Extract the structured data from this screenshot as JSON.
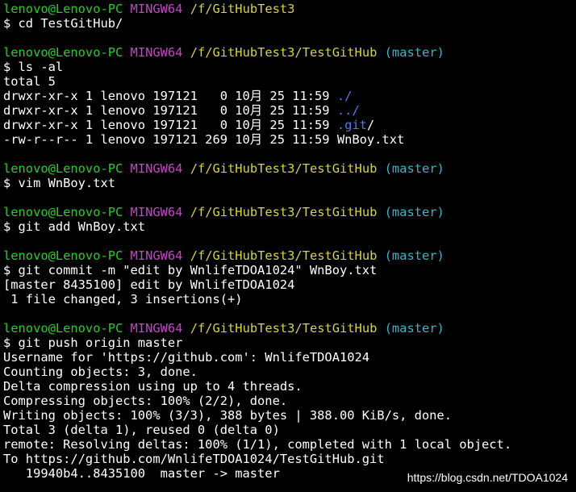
{
  "prompt": {
    "user_host": "lenovo@Lenovo-PC",
    "env": "MINGW64",
    "path_root": "/f/GitHubTest3",
    "path_repo": "/f/GitHubTest3/TestGitHub",
    "branch": "(master)"
  },
  "commands": {
    "cd": "$ cd TestGitHub/",
    "ls": "$ ls -al",
    "vim": "$ vim WnBoy.txt",
    "add": "$ git add WnBoy.txt",
    "commit": "$ git commit -m \"edit by WnlifeTDOA1024\" WnBoy.txt",
    "push": "$ git push origin master"
  },
  "ls_output": {
    "total": "total 5",
    "rows": [
      {
        "prefix": "drwxr-xr-x 1 lenovo 197121   0 10月 25 11:59 ",
        "name": "./",
        "kind": "dir"
      },
      {
        "prefix": "drwxr-xr-x 1 lenovo 197121   0 10月 25 11:59 ",
        "name": "../",
        "kind": "dir"
      },
      {
        "prefix": "drwxr-xr-x 1 lenovo 197121   0 10月 25 11:59 ",
        "name": ".git",
        "suffix": "/",
        "kind": "dir"
      },
      {
        "prefix": "-rw-r--r-- 1 lenovo 197121 269 10月 25 11:59 ",
        "name": "WnBoy.txt",
        "kind": "file"
      }
    ]
  },
  "commit_output": [
    "[master 8435100] edit by WnlifeTDOA1024",
    " 1 file changed, 3 insertions(+)"
  ],
  "push_output": [
    "Username for 'https://github.com': WnlifeTDOA1024",
    "Counting objects: 3, done.",
    "Delta compression using up to 4 threads.",
    "Compressing objects: 100% (2/2), done.",
    "Writing objects: 100% (3/3), 388 bytes | 388.00 KiB/s, done.",
    "Total 3 (delta 1), reused 0 (delta 0)",
    "remote: Resolving deltas: 100% (1/1), completed with 1 local object.",
    "To https://github.com/WnlifeTDOA1024/TestGitHub.git",
    "   19940b4..8435100  master -> master"
  ],
  "watermark": "https://blog.csdn.net/TDOA1024",
  "colors": {
    "background": "#000000",
    "text": "#ffffff",
    "user_host": "#1ed31e",
    "env": "#c745c7",
    "path": "#d6d62b",
    "branch": "#2fb9c8",
    "directory": "#4d7cf2"
  }
}
